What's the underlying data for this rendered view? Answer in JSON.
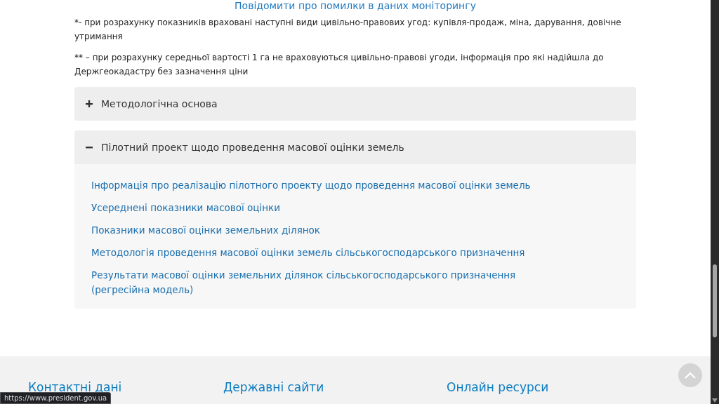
{
  "top_link": "Повідомити про помилки в даних моніторингу",
  "notes": [
    "*- при розрахунку показників враховані наступні види цивільно-правових угод: купівля-продаж, міна, дарування, довічне утримання",
    "** – при розрахунку середньої вартості 1 га не враховуються цивільно-правові угоди, інформація про які надійшла до Держгеокадастру без зазначення ціни"
  ],
  "accordion": [
    {
      "title": "Методологічна основа",
      "expanded": false
    },
    {
      "title": "Пілотний проект щодо проведення масової оцінки земель",
      "expanded": true,
      "links": [
        "Інформація про реалізацію пілотного проекту щодо проведення масової оцінки земель",
        "Усереднені показники масової оцінки",
        "Показники масової оцінки земельних ділянок",
        "Методологія проведення масової оцінки земель сільськогосподарського призначення",
        "Результати масової оцінки земельних ділянок сільськогосподарського призначення (регресійна модель)"
      ]
    }
  ],
  "footer": {
    "headings": [
      "Контактні дані",
      "Державні сайти",
      "Онлайн ресурси"
    ]
  },
  "status_url": "https://www.president.gov.ua"
}
